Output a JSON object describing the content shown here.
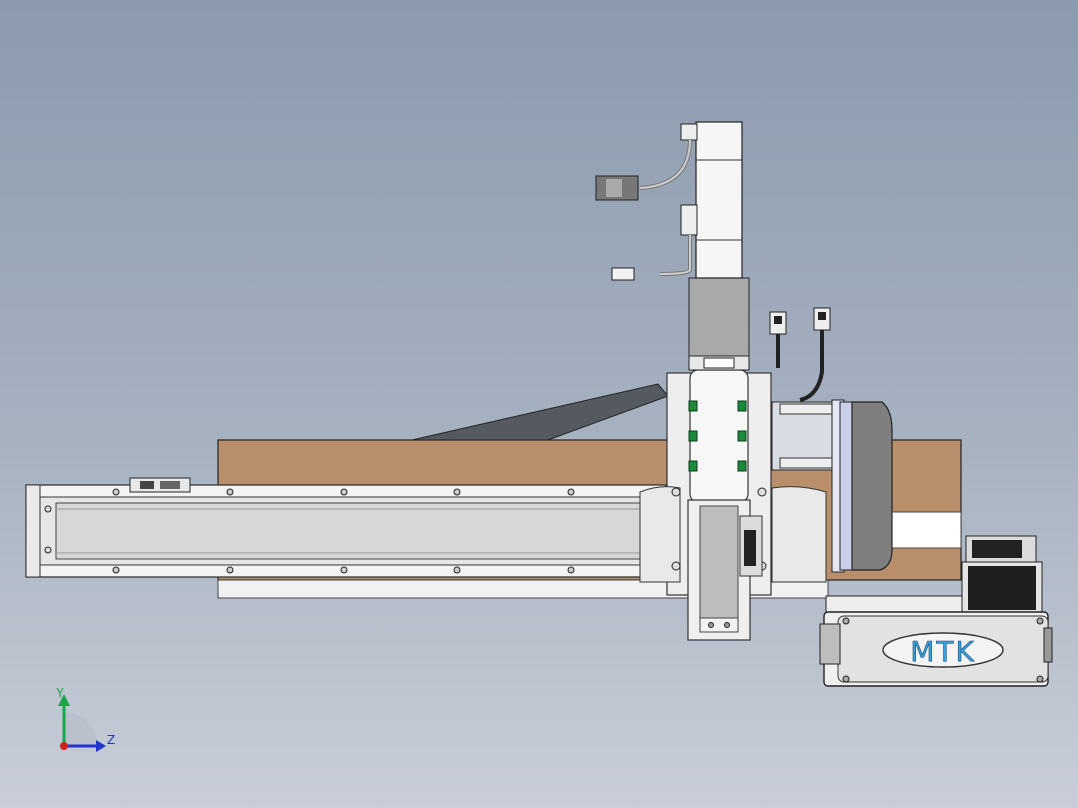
{
  "viewport": {
    "background_top": "#8b9aae",
    "background_bottom": "#c9ced8"
  },
  "model": {
    "brand_label": "MTK",
    "brand_color": "#3aa0d8",
    "base_plate_color": "#b98e6a",
    "aluminum_color": "#eeeeee",
    "motor_color": "#d9dde3",
    "connector_green": "#1a8a3a"
  },
  "triad": {
    "y_label": "Y",
    "z_label": "Z",
    "y_color": "#1aa54a",
    "z_color": "#2233cc",
    "x_color": "#cc2222"
  }
}
